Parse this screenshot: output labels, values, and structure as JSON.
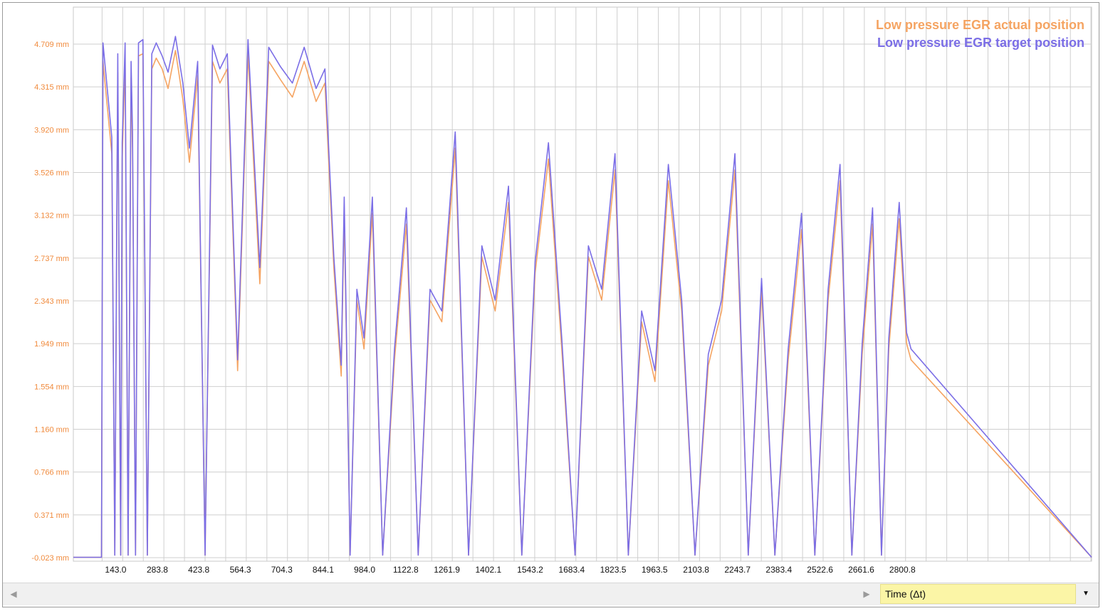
{
  "chart_data": {
    "type": "line",
    "title": "",
    "xlabel": "Time (Δt)",
    "ylabel": "",
    "y_unit": "mm",
    "grid": true,
    "legend_position": "top-right",
    "xlim": [
      0,
      3440
    ],
    "ylim": [
      -0.023,
      4.809
    ],
    "y_ticks": [
      -0.023,
      0.371,
      0.766,
      1.16,
      1.554,
      1.949,
      2.343,
      2.737,
      3.132,
      3.526,
      3.92,
      4.315,
      4.709
    ],
    "y_tick_labels": [
      "-0.023 mm",
      "0.371 mm",
      "0.766 mm",
      "1.160 mm",
      "1.554 mm",
      "1.949 mm",
      "2.343 mm",
      "2.737 mm",
      "3.132 mm",
      "3.526 mm",
      "3.920 mm",
      "4.315 mm",
      "4.709 mm"
    ],
    "x_ticks": [
      143.0,
      283.8,
      423.8,
      564.3,
      704.3,
      844.1,
      984.0,
      1122.8,
      1261.9,
      1402.1,
      1543.2,
      1683.4,
      1823.5,
      1963.5,
      2103.8,
      2243.7,
      2383.4,
      2522.6,
      2661.6,
      2800.8
    ],
    "x_tick_labels": [
      "143.0",
      "283.8",
      "423.8",
      "564.3",
      "704.3",
      "844.1",
      "984.0",
      "1122.8",
      "1261.9",
      "1402.1",
      "1543.2",
      "1683.4",
      "1823.5",
      "1963.5",
      "2103.8",
      "2243.7",
      "2383.4",
      "2522.6",
      "2661.6",
      "2800.8"
    ],
    "series": [
      {
        "name": "Low pressure EGR actual position",
        "color": "#f5a462",
        "x": [
          0,
          95,
          100,
          130,
          140,
          150,
          160,
          165,
          175,
          185,
          195,
          200,
          210,
          220,
          235,
          250,
          265,
          280,
          300,
          320,
          345,
          370,
          392,
          420,
          445,
          470,
          495,
          520,
          555,
          590,
          630,
          660,
          700,
          740,
          780,
          820,
          850,
          880,
          905,
          915,
          935,
          958,
          982,
          1010,
          1045,
          1085,
          1125,
          1165,
          1205,
          1245,
          1290,
          1335,
          1380,
          1425,
          1470,
          1515,
          1560,
          1605,
          1650,
          1695,
          1740,
          1785,
          1830,
          1875,
          1920,
          1965,
          2010,
          2055,
          2100,
          2145,
          2190,
          2235,
          2280,
          2325,
          2370,
          2415,
          2460,
          2505,
          2550,
          2590,
          2630,
          2665,
          2700,
          2730,
          2755,
          2790,
          2815,
          2830,
          3440
        ],
        "y": [
          -0.02,
          -0.02,
          4.55,
          3.7,
          0.0,
          4.45,
          0.0,
          3.65,
          4.55,
          0.0,
          4.4,
          3.75,
          0.0,
          4.6,
          4.62,
          0.0,
          4.48,
          4.58,
          4.48,
          4.3,
          4.65,
          4.2,
          3.62,
          4.42,
          0.0,
          4.55,
          4.35,
          4.48,
          1.7,
          4.62,
          2.5,
          4.55,
          4.38,
          4.22,
          4.55,
          4.18,
          4.35,
          2.65,
          1.65,
          3.15,
          0.0,
          2.35,
          1.9,
          3.15,
          0.0,
          1.8,
          3.05,
          0.0,
          2.35,
          2.15,
          3.75,
          0.0,
          2.75,
          2.25,
          3.25,
          0.0,
          2.6,
          3.65,
          1.9,
          0.0,
          2.75,
          2.35,
          3.55,
          0.0,
          2.15,
          1.6,
          3.45,
          2.25,
          0.0,
          1.75,
          2.25,
          3.55,
          0.0,
          2.45,
          0.0,
          1.8,
          3.0,
          0.0,
          2.35,
          3.45,
          0.0,
          1.85,
          3.05,
          0.0,
          1.9,
          3.1,
          1.95,
          1.8,
          -0.02
        ]
      },
      {
        "name": "Low pressure EGR target position",
        "color": "#7b6ee6",
        "x": [
          0,
          95,
          100,
          130,
          140,
          150,
          160,
          165,
          175,
          185,
          195,
          200,
          210,
          220,
          235,
          250,
          265,
          280,
          300,
          320,
          345,
          370,
          392,
          420,
          445,
          470,
          495,
          520,
          555,
          590,
          630,
          660,
          700,
          740,
          780,
          820,
          850,
          880,
          905,
          915,
          935,
          958,
          982,
          1010,
          1045,
          1085,
          1125,
          1165,
          1205,
          1245,
          1290,
          1335,
          1380,
          1425,
          1470,
          1515,
          1560,
          1605,
          1650,
          1695,
          1740,
          1785,
          1830,
          1875,
          1920,
          1965,
          2010,
          2055,
          2100,
          2145,
          2190,
          2235,
          2280,
          2325,
          2370,
          2415,
          2460,
          2505,
          2550,
          2590,
          2630,
          2665,
          2700,
          2730,
          2755,
          2790,
          2815,
          2830,
          3440
        ],
        "y": [
          -0.02,
          -0.02,
          4.72,
          3.85,
          0.0,
          4.62,
          0.0,
          3.8,
          4.72,
          0.0,
          4.55,
          3.9,
          0.0,
          4.72,
          4.75,
          0.0,
          4.62,
          4.72,
          4.6,
          4.45,
          4.78,
          4.35,
          3.75,
          4.55,
          0.0,
          4.7,
          4.48,
          4.62,
          1.8,
          4.75,
          2.65,
          4.68,
          4.5,
          4.35,
          4.68,
          4.3,
          4.48,
          2.75,
          1.75,
          3.3,
          0.0,
          2.45,
          2.0,
          3.3,
          0.0,
          1.9,
          3.2,
          0.0,
          2.45,
          2.25,
          3.9,
          0.0,
          2.85,
          2.35,
          3.4,
          0.0,
          2.7,
          3.8,
          2.0,
          0.0,
          2.85,
          2.45,
          3.7,
          0.0,
          2.25,
          1.7,
          3.6,
          2.35,
          0.0,
          1.85,
          2.35,
          3.7,
          0.0,
          2.55,
          0.0,
          1.9,
          3.15,
          0.0,
          2.45,
          3.6,
          0.0,
          1.95,
          3.2,
          0.0,
          2.0,
          3.25,
          2.05,
          1.9,
          -0.02
        ]
      }
    ]
  },
  "bottom_bar": {
    "scroll_left_icon": "◀",
    "scroll_right_icon": "▶",
    "axis_selector_value": "Time (Δt)",
    "dropdown_icon": "▼",
    "selector_color": "#fbf5a6"
  }
}
